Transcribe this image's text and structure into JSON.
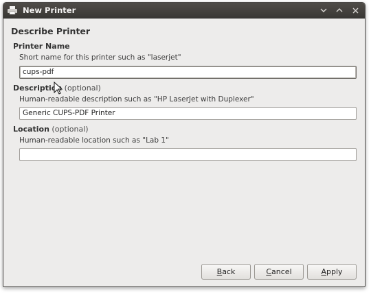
{
  "window": {
    "title": "New Printer",
    "controls": [
      "chevron-down-icon",
      "chevron-up-icon",
      "close-icon"
    ]
  },
  "page": {
    "heading": "Describe Printer"
  },
  "printer_name": {
    "label": "Printer Name",
    "hint": "Short name for this printer such as \"laserjet\"",
    "value": "cups-pdf"
  },
  "description": {
    "label": "Description",
    "optional": " (optional)",
    "hint": "Human-readable description such as \"HP LaserJet with Duplexer\"",
    "value": "Generic CUPS-PDF Printer"
  },
  "location": {
    "label": "Location",
    "optional": " (optional)",
    "hint": "Human-readable location such as \"Lab 1\"",
    "value": ""
  },
  "buttons": {
    "back": {
      "mnemonic": "B",
      "rest": "ack"
    },
    "cancel": {
      "mnemonic": "C",
      "rest": "ancel"
    },
    "apply": {
      "mnemonic": "A",
      "rest": "pply"
    }
  },
  "colors": {
    "titlebar": "#3f3d3a",
    "window_bg": "#edeceb",
    "title_text": "#f4f3f2"
  }
}
